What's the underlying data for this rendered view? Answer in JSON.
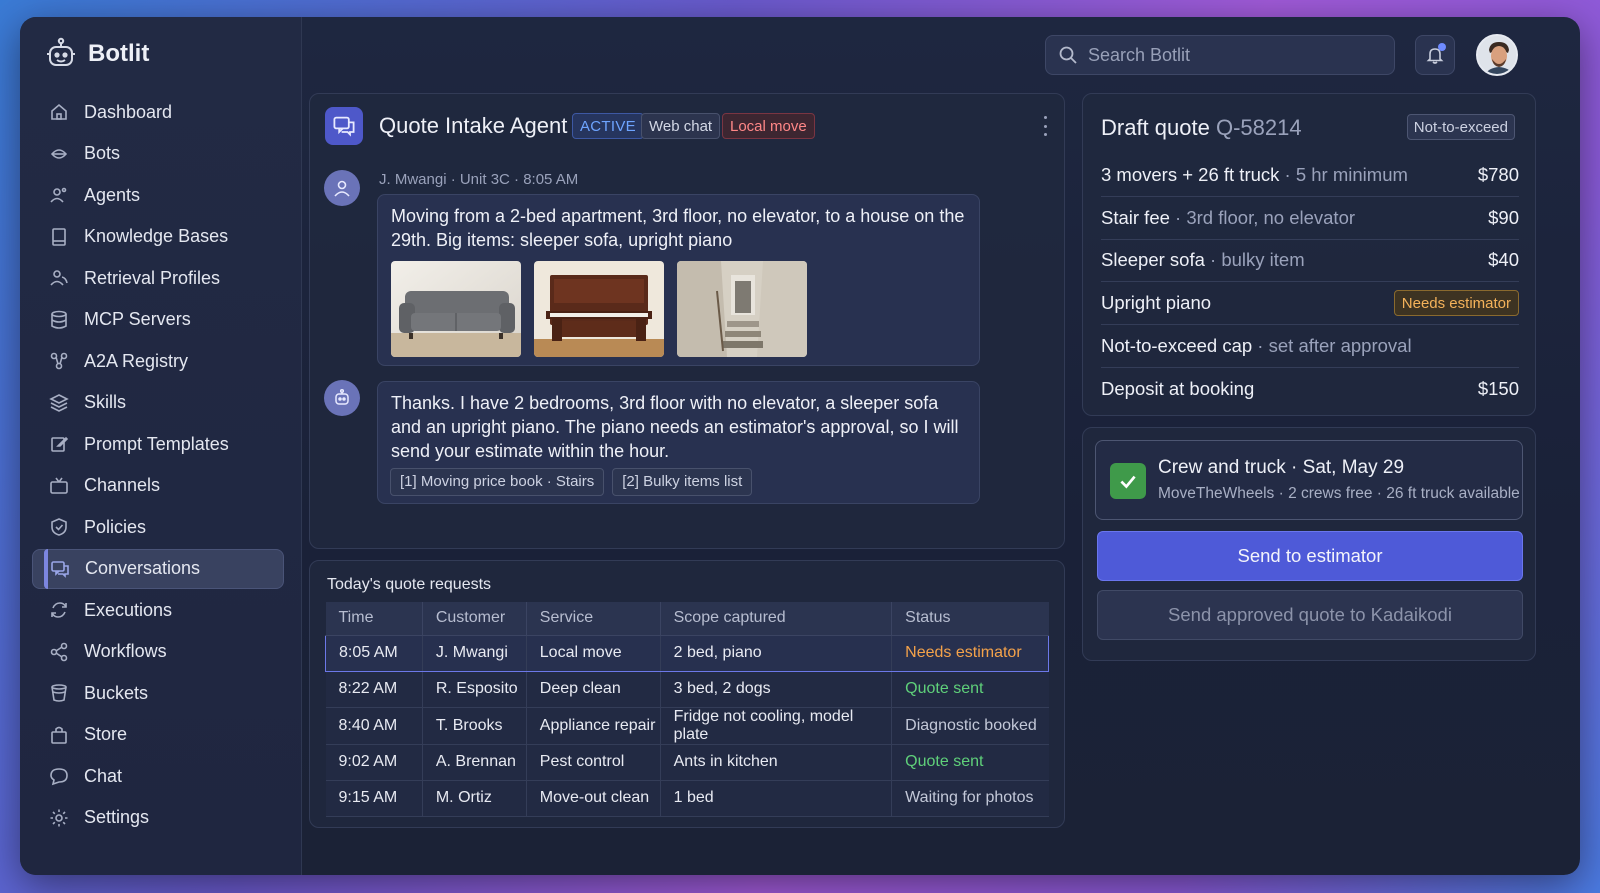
{
  "app": {
    "name": "Botlit"
  },
  "search": {
    "placeholder": "Search Botlit"
  },
  "sidebar": {
    "items": [
      {
        "label": "Dashboard",
        "icon": "home-icon"
      },
      {
        "label": "Bots",
        "icon": "bot-icon"
      },
      {
        "label": "Agents",
        "icon": "agents-icon"
      },
      {
        "label": "Knowledge Bases",
        "icon": "book-icon"
      },
      {
        "label": "Retrieval Profiles",
        "icon": "users-icon"
      },
      {
        "label": "MCP Servers",
        "icon": "database-icon"
      },
      {
        "label": "A2A Registry",
        "icon": "network-icon"
      },
      {
        "label": "Skills",
        "icon": "layers-icon"
      },
      {
        "label": "Prompt Templates",
        "icon": "edit-icon"
      },
      {
        "label": "Channels",
        "icon": "tv-icon"
      },
      {
        "label": "Policies",
        "icon": "shield-icon"
      },
      {
        "label": "Conversations",
        "icon": "chat-bubbles-icon",
        "active": true
      },
      {
        "label": "Executions",
        "icon": "refresh-icon"
      },
      {
        "label": "Workflows",
        "icon": "share-icon"
      },
      {
        "label": "Buckets",
        "icon": "bucket-icon"
      },
      {
        "label": "Store",
        "icon": "bag-icon"
      },
      {
        "label": "Chat",
        "icon": "chat-icon"
      },
      {
        "label": "Settings",
        "icon": "gear-icon"
      }
    ]
  },
  "agent": {
    "title": "Quote Intake Agent",
    "status": "ACTIVE",
    "channel": "Web chat",
    "tag": "Local move"
  },
  "messages": {
    "customer": {
      "meta": "J. Mwangi · Unit 3C · 8:05 AM",
      "text": "Moving from a 2-bed apartment, 3rd floor, no elevator, to a house on the 29th. Big items: sleeper sofa, upright piano"
    },
    "bot": {
      "text": "Thanks. I have 2 bedrooms, 3rd floor with no elevator, a sleeper sofa and an upright piano. The piano needs an estimator's approval, so I will send your estimate within the hour.",
      "citations": [
        "[1] Moving price book · Stairs",
        "[2] Bulky items list"
      ]
    }
  },
  "requests": {
    "title": "Today's quote requests",
    "columns": [
      "Time",
      "Customer",
      "Service",
      "Scope captured",
      "Status"
    ],
    "rows": [
      {
        "time": "8:05 AM",
        "customer": "J. Mwangi",
        "service": "Local move",
        "scope": "2 bed, piano",
        "status": "Needs estimator",
        "status_color": "#f4a24a",
        "selected": true
      },
      {
        "time": "8:22 AM",
        "customer": "R. Esposito",
        "service": "Deep clean",
        "scope": "3 bed, 2 dogs",
        "status": "Quote sent",
        "status_color": "#5fd07a"
      },
      {
        "time": "8:40 AM",
        "customer": "T. Brooks",
        "service": "Appliance repair",
        "scope": "Fridge not cooling, model plate",
        "status": "Diagnostic booked",
        "status_color": "#c3c8d8"
      },
      {
        "time": "9:02 AM",
        "customer": "A. Brennan",
        "service": "Pest control",
        "scope": "Ants in kitchen",
        "status": "Quote sent",
        "status_color": "#5fd07a"
      },
      {
        "time": "9:15 AM",
        "customer": "M. Ortiz",
        "service": "Move-out clean",
        "scope": "1 bed",
        "status": "Waiting for photos",
        "status_color": "#c3c8d8"
      }
    ]
  },
  "quote": {
    "title": "Draft quote",
    "id": "Q-58214",
    "badge": "Not-to-exceed",
    "lines": [
      {
        "label": "3 movers + 26 ft truck",
        "sub": "5 hr minimum",
        "amount": "$780"
      },
      {
        "label": "Stair fee",
        "sub": "3rd floor, no elevator",
        "amount": "$90"
      },
      {
        "label": "Sleeper sofa",
        "sub": "bulky item",
        "amount": "$40"
      },
      {
        "label": "Upright piano",
        "sub": "",
        "amount": "",
        "flag": "Needs estimator"
      },
      {
        "label": "Not-to-exceed cap",
        "sub": "set after approval",
        "amount": ""
      },
      {
        "label": "Deposit at booking",
        "sub": "",
        "amount": "$150"
      }
    ]
  },
  "crew": {
    "title": "Crew and truck · Sat, May 29",
    "subtitle": "MoveTheWheels · 2 crews free · 26 ft truck available"
  },
  "actions": {
    "send_estimator": "Send to estimator",
    "send_approved": "Send approved quote to Kadaikodi"
  },
  "colors": {
    "accent": "#4e5ad8",
    "success": "#3f9a4a",
    "warning": "#f4a24a",
    "danger": "#ff8787"
  }
}
